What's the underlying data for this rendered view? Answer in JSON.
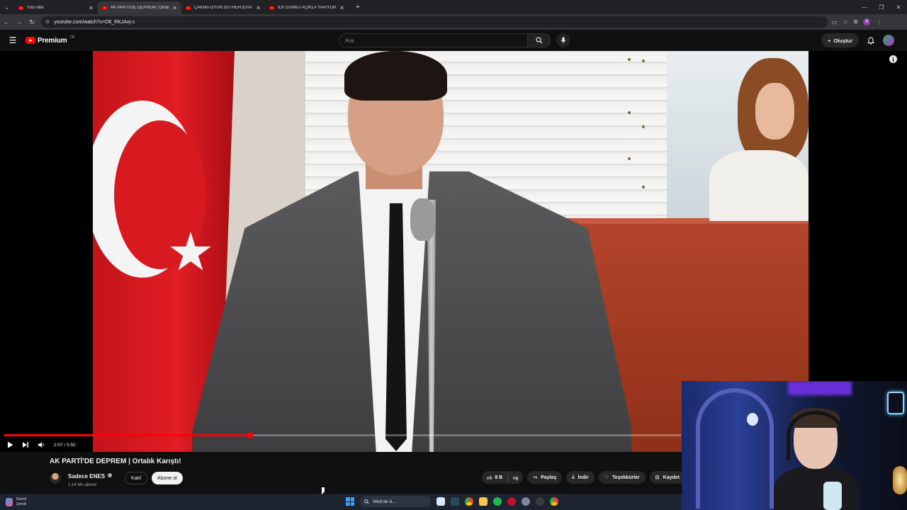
{
  "browser": {
    "tabs": [
      {
        "title": "YouTube",
        "active": false
      },
      {
        "title": "AK PARTİ'DE DEPREM | Ortalık",
        "active": true
      },
      {
        "title": "ÇAKMA OYUN SUTHERJOYA",
        "active": false
      },
      {
        "title": "İLK GÜNKÜ AÇIKLA YAPIYORUM",
        "active": false
      }
    ],
    "url": "youtube.com/watch?v=O6_RKJAej-c"
  },
  "youtube": {
    "logo_text": "Premium",
    "logo_region": "TR",
    "search_placeholder": "Ara",
    "create_label": "Oluştur"
  },
  "player": {
    "time_current": "2:07",
    "time_total": "5:50",
    "progress_fraction": 0.363
  },
  "video": {
    "title": "AK PARTİ'DE DEPREM | Ortalık Karıştı!",
    "channel_name": "Sadece ENES",
    "subscribers": "1,14 Mn abone",
    "join_label": "Katıl",
    "subscribe_label": "Abone ol",
    "like_count": "8 B",
    "share_label": "Paylaş",
    "download_label": "İndir",
    "thanks_label": "Teşekkürler",
    "save_label": "Kaydet"
  },
  "taskbar": {
    "notif_line1": "Nemli",
    "notif_line2": "Şimdi",
    "search_label": "Web'de &..."
  },
  "colors": {
    "accent": "#ff0000",
    "background": "#0f0f0f",
    "pill": "#272727"
  }
}
